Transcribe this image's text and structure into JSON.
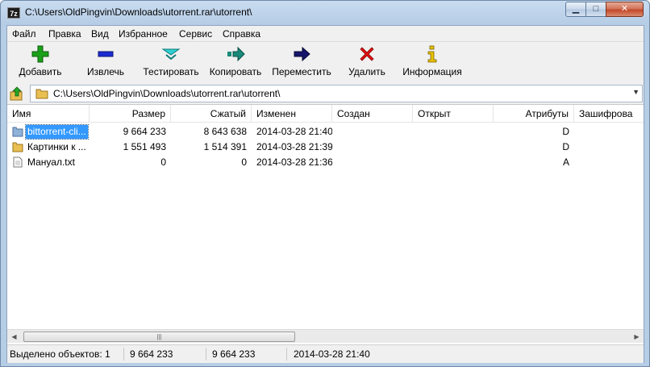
{
  "window": {
    "title": "C:\\Users\\OldPingvin\\Downloads\\utorrent.rar\\utorrent\\",
    "app_icon_text": "7z",
    "minimize": "▁",
    "maximize": "□",
    "close": "✕"
  },
  "menu": [
    {
      "label": "Файл"
    },
    {
      "label": "Правка"
    },
    {
      "label": "Вид"
    },
    {
      "label": "Избранное"
    },
    {
      "label": "Сервис"
    },
    {
      "label": "Справка"
    }
  ],
  "toolbar": [
    {
      "label": "Добавить",
      "icon": "add-icon",
      "color": "#1aa11a"
    },
    {
      "label": "Извлечь",
      "icon": "extract-icon",
      "color": "#1c2bd4"
    },
    {
      "label": "Тестировать",
      "icon": "test-icon",
      "color": "#1fb5b5"
    },
    {
      "label": "Копировать",
      "icon": "copy-icon",
      "color": "#1a8a7a"
    },
    {
      "label": "Переместить",
      "icon": "move-icon",
      "color": "#16166b"
    },
    {
      "label": "Удалить",
      "icon": "delete-icon",
      "color": "#e01010"
    },
    {
      "label": "Информация",
      "icon": "info-icon",
      "color": "#e8c000"
    }
  ],
  "address": {
    "path": "C:\\Users\\OldPingvin\\Downloads\\utorrent.rar\\utorrent\\"
  },
  "columns": [
    "Имя",
    "Размер",
    "Сжатый",
    "Изменен",
    "Создан",
    "Открыт",
    "Атрибуты",
    "Зашифрова"
  ],
  "rows": [
    {
      "name": "bittorrent-cli...",
      "size": "9 664 233",
      "packed": "8 643 638",
      "modified": "2014-03-28 21:40",
      "created": "",
      "accessed": "",
      "attributes": "D",
      "encrypted": "",
      "type": "folder",
      "selected": true
    },
    {
      "name": "Картинки к ...",
      "size": "1 551 493",
      "packed": "1 514 391",
      "modified": "2014-03-28 21:39",
      "created": "",
      "accessed": "",
      "attributes": "D",
      "encrypted": "",
      "type": "folder",
      "selected": false
    },
    {
      "name": "Мануал.txt",
      "size": "0",
      "packed": "0",
      "modified": "2014-03-28 21:36",
      "created": "",
      "accessed": "",
      "attributes": "A",
      "encrypted": "",
      "type": "file",
      "selected": false
    }
  ],
  "status": {
    "selected": "Выделено объектов: 1",
    "size": "9 664 233",
    "packed": "9 664 233",
    "modified": "2014-03-28 21:40"
  },
  "scrollbar": {
    "left_arrow": "◀",
    "right_arrow": "▶",
    "grip": "|||"
  },
  "colors": {
    "selection": "#3399ff",
    "folder": "#e9bf52"
  }
}
